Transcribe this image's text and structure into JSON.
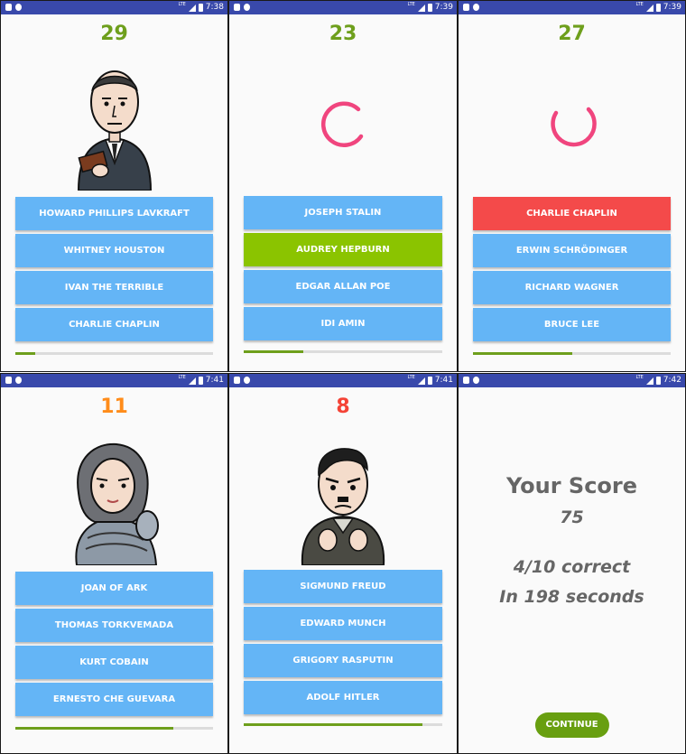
{
  "colors": {
    "status_bar": "#3949ab",
    "answer_default": "#64b5f6",
    "answer_correct": "#8bc400",
    "answer_wrong": "#f44a4a",
    "timer_green": "#6e9f1c",
    "timer_orange": "#ff8c1a",
    "timer_red": "#f44336",
    "spinner": "#f0457e",
    "progress_fill": "#6e9f1c",
    "continue_button": "#689f10"
  },
  "screens": [
    {
      "status": {
        "network": "LTE",
        "time": "7:38"
      },
      "timer": "29",
      "portrait_icon": "lovecraft-caricature",
      "answers": [
        "HOWARD PHILLIPS LAVKRAFT",
        "WHITNEY HOUSTON",
        "IVAN THE TERRIBLE",
        "CHARLIE CHAPLIN"
      ],
      "progress": 0.1
    },
    {
      "status": {
        "network": "LTE",
        "time": "7:39"
      },
      "timer": "23",
      "spinner_icon": "loading-spinner",
      "answers": [
        "JOSEPH STALIN",
        "AUDREY HEPBURN",
        "EDGAR ALLAN POE",
        "IDI AMIN"
      ],
      "highlight": {
        "index": 1,
        "state": "correct"
      },
      "progress": 0.3
    },
    {
      "status": {
        "network": "LTE",
        "time": "7:39"
      },
      "timer": "27",
      "spinner_icon": "loading-spinner",
      "answers": [
        "CHARLIE CHAPLIN",
        "ERWIN SCHRÖDINGER",
        "RICHARD WAGNER",
        "BRUCE LEE"
      ],
      "highlight": {
        "index": 0,
        "state": "wrong"
      },
      "progress": 0.5
    },
    {
      "status": {
        "network": "LTE",
        "time": "7:41"
      },
      "timer": "11",
      "portrait_icon": "joan-of-arc-caricature",
      "answers": [
        "JOAN OF ARK",
        "THOMAS TORKVEMADA",
        "KURT COBAIN",
        "ERNESTO CHE GUEVARA"
      ],
      "progress": 0.8
    },
    {
      "status": {
        "network": "LTE",
        "time": "7:41"
      },
      "timer": "8",
      "portrait_icon": "hitler-caricature",
      "answers": [
        "SIGMUND FREUD",
        "EDWARD MUNCH",
        "GRIGORY RASPUTIN",
        "ADOLF HITLER"
      ],
      "progress": 0.9
    }
  ],
  "result_screen": {
    "status": {
      "network": "LTE",
      "time": "7:42"
    },
    "title": "Your Score",
    "score": "75",
    "correct_text": "4/10 correct",
    "time_text": "In 198 seconds",
    "continue_label": "CONTINUE"
  }
}
